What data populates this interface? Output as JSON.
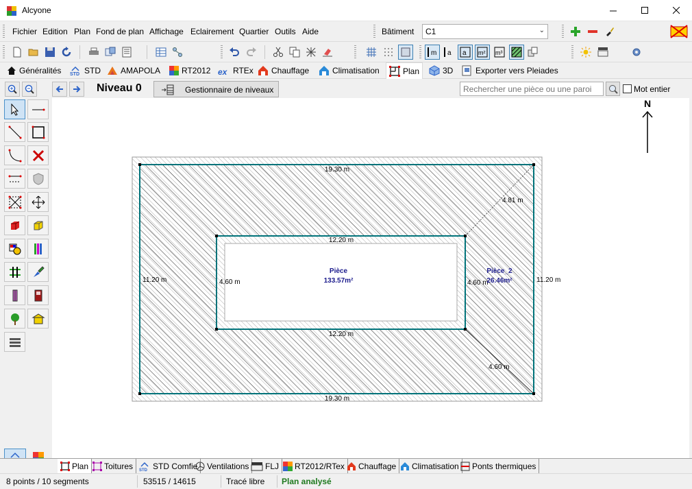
{
  "window": {
    "title": "Alcyone"
  },
  "menu": {
    "items": [
      "Fichier",
      "Edition",
      "Plan",
      "Fond de plan",
      "Affichage",
      "Eclairement",
      "Quartier",
      "Outils",
      "Aide"
    ],
    "batiment_label": "Bâtiment",
    "batiment_value": "C1"
  },
  "module_tabs": [
    "Généralités",
    "STD",
    "AMAPOLA",
    "RT2012",
    "RTEx",
    "Chauffage",
    "Climatisation",
    "Plan",
    "3D",
    "Exporter vers Pleiades"
  ],
  "active_module_tab": "Plan",
  "level": {
    "name": "Niveau 0",
    "manager_button": "Gestionnaire de niveaux",
    "search_placeholder": "Rechercher une pièce ou une paroi",
    "whole_word_label": "Mot entier",
    "whole_word_checked": false
  },
  "compass": {
    "label": "N"
  },
  "plan": {
    "outer_top": "19.30 m",
    "outer_bottom": "19.30 m",
    "outer_left": "11.20 m",
    "outer_right": "11.20 m",
    "inner_top": "12.20 m",
    "inner_bottom": "12.20 m",
    "inner_left": "4.60 m",
    "inner_right": "4.60 m",
    "diag_top": "4.81 m",
    "diag_bottom": "4.60 m",
    "room1_name": "Pièce",
    "room1_area": "133.57m²",
    "room2_name": "Pièce_2",
    "room2_area": "26.46m²",
    "colors": {
      "wall_outline": "#00737a",
      "room_label": "#1a1a8c",
      "hatch": "#333333"
    }
  },
  "bottom_tabs": [
    "Plan",
    "Toitures",
    "STD Comfie",
    "Ventilations",
    "FLJ",
    "RT2012/RTex",
    "Chauffage",
    "Climatisation",
    "Ponts thermiques"
  ],
  "status": {
    "points": "8 points / 10 segments",
    "coords": "53515 / 14615",
    "mode": "Tracé libre",
    "analysis": "Plan analysé",
    "analysis_color": "#1f7a1f"
  }
}
